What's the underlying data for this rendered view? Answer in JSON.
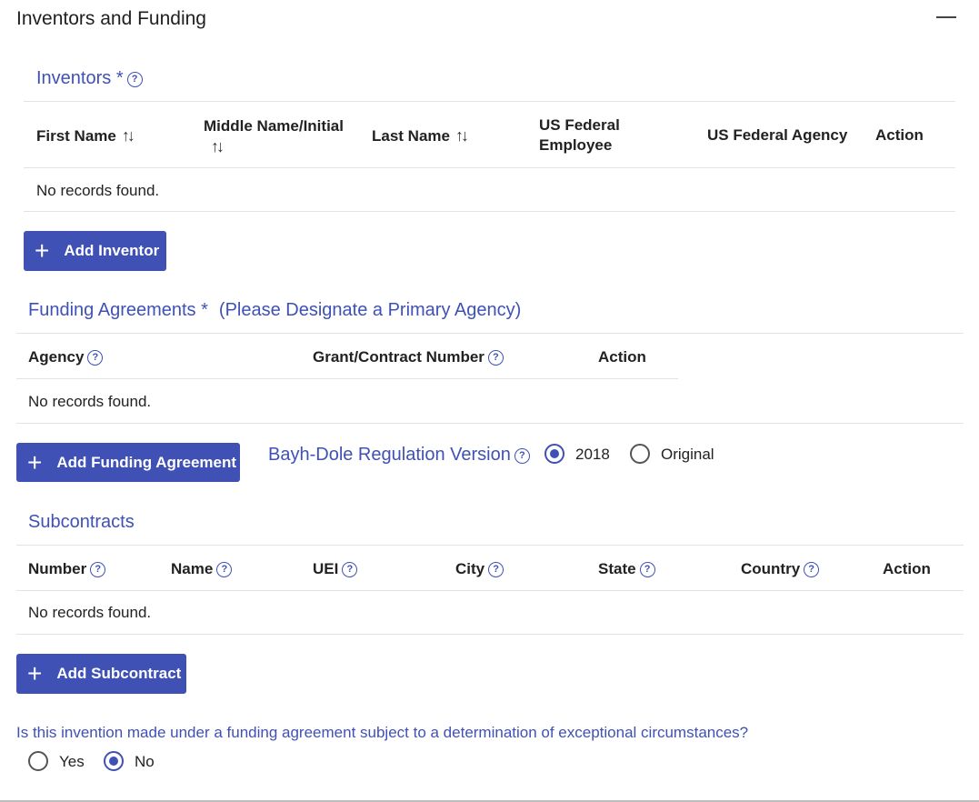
{
  "panel": {
    "title": "Inventors and Funding"
  },
  "inventors": {
    "title": "Inventors *",
    "columns": [
      "First Name",
      "Middle Name/Initial",
      "Last Name",
      "US Federal Employee",
      "US Federal Agency",
      "Action"
    ],
    "empty": "No records found.",
    "add_label": "Add Inventor"
  },
  "funding": {
    "title": "Funding Agreements *",
    "note": "(Please Designate a Primary Agency)",
    "columns": [
      "Agency",
      "Grant/Contract Number",
      "Action"
    ],
    "empty": "No records found.",
    "add_label": "Add Funding Agreement",
    "regulation_label": "Bayh-Dole Regulation Version",
    "regulation_options": [
      "2018",
      "Original"
    ],
    "regulation_selected": "2018"
  },
  "subcontracts": {
    "title": "Subcontracts",
    "columns": [
      "Number",
      "Name",
      "UEI",
      "City",
      "State",
      "Country",
      "Action"
    ],
    "empty": "No records found.",
    "add_label": "Add Subcontract"
  },
  "exceptional": {
    "question": "Is this invention made under a funding agreement subject to a determination of exceptional circumstances?",
    "options": [
      "Yes",
      "No"
    ],
    "selected": "No"
  },
  "icons": {
    "help": "help-circle-icon",
    "sort": "sort-icon",
    "plus": "plus-icon",
    "collapse": "minus-icon"
  },
  "colors": {
    "accent": "#3f51b5"
  }
}
